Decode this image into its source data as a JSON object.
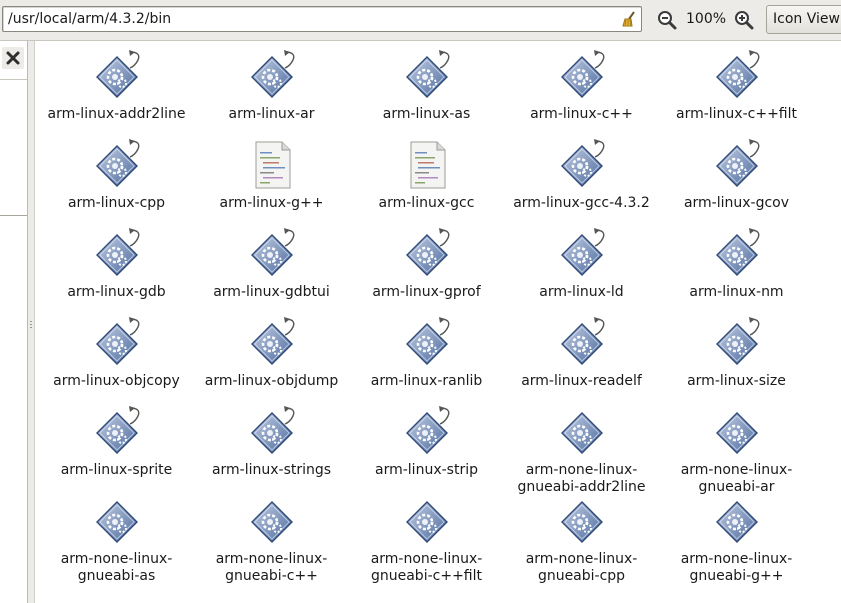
{
  "toolbar": {
    "path": "/usr/local/arm/4.3.2/bin",
    "zoom_level": "100%",
    "view_mode": "Icon View",
    "icons": {
      "clear": "broom-icon",
      "zoom_out": "zoom-out-icon",
      "zoom_in": "zoom-in-icon"
    }
  },
  "sidepane": {
    "close_icon": "close-icon"
  },
  "files": [
    {
      "line1": "arm-linux-addr2line",
      "line2": "",
      "kind": "executable",
      "symlink": true
    },
    {
      "line1": "arm-linux-ar",
      "line2": "",
      "kind": "executable",
      "symlink": true
    },
    {
      "line1": "arm-linux-as",
      "line2": "",
      "kind": "executable",
      "symlink": true
    },
    {
      "line1": "arm-linux-c++",
      "line2": "",
      "kind": "executable",
      "symlink": true
    },
    {
      "line1": "arm-linux-c++filt",
      "line2": "",
      "kind": "executable",
      "symlink": true
    },
    {
      "line1": "arm-linux-cpp",
      "line2": "",
      "kind": "executable",
      "symlink": true
    },
    {
      "line1": "arm-linux-g++",
      "line2": "",
      "kind": "script",
      "symlink": false
    },
    {
      "line1": "arm-linux-gcc",
      "line2": "",
      "kind": "script",
      "symlink": false
    },
    {
      "line1": "arm-linux-gcc-4.3.2",
      "line2": "",
      "kind": "executable",
      "symlink": true
    },
    {
      "line1": "arm-linux-gcov",
      "line2": "",
      "kind": "executable",
      "symlink": true
    },
    {
      "line1": "arm-linux-gdb",
      "line2": "",
      "kind": "executable",
      "symlink": true
    },
    {
      "line1": "arm-linux-gdbtui",
      "line2": "",
      "kind": "executable",
      "symlink": true
    },
    {
      "line1": "arm-linux-gprof",
      "line2": "",
      "kind": "executable",
      "symlink": true
    },
    {
      "line1": "arm-linux-ld",
      "line2": "",
      "kind": "executable",
      "symlink": true
    },
    {
      "line1": "arm-linux-nm",
      "line2": "",
      "kind": "executable",
      "symlink": true
    },
    {
      "line1": "arm-linux-objcopy",
      "line2": "",
      "kind": "executable",
      "symlink": true
    },
    {
      "line1": "arm-linux-objdump",
      "line2": "",
      "kind": "executable",
      "symlink": true
    },
    {
      "line1": "arm-linux-ranlib",
      "line2": "",
      "kind": "executable",
      "symlink": true
    },
    {
      "line1": "arm-linux-readelf",
      "line2": "",
      "kind": "executable",
      "symlink": true
    },
    {
      "line1": "arm-linux-size",
      "line2": "",
      "kind": "executable",
      "symlink": true
    },
    {
      "line1": "arm-linux-sprite",
      "line2": "",
      "kind": "executable",
      "symlink": true
    },
    {
      "line1": "arm-linux-strings",
      "line2": "",
      "kind": "executable",
      "symlink": true
    },
    {
      "line1": "arm-linux-strip",
      "line2": "",
      "kind": "executable",
      "symlink": true
    },
    {
      "line1": "arm-none-linux-",
      "line2": "gnueabi-addr2line",
      "kind": "executable",
      "symlink": false
    },
    {
      "line1": "arm-none-linux-",
      "line2": "gnueabi-ar",
      "kind": "executable",
      "symlink": false
    },
    {
      "line1": "arm-none-linux-",
      "line2": "gnueabi-as",
      "kind": "executable",
      "symlink": false
    },
    {
      "line1": "arm-none-linux-",
      "line2": "gnueabi-c++",
      "kind": "executable",
      "symlink": false
    },
    {
      "line1": "arm-none-linux-",
      "line2": "gnueabi-c++filt",
      "kind": "executable",
      "symlink": false
    },
    {
      "line1": "arm-none-linux-",
      "line2": "gnueabi-cpp",
      "kind": "executable",
      "symlink": false
    },
    {
      "line1": "arm-none-linux-",
      "line2": "gnueabi-g++",
      "kind": "executable",
      "symlink": false
    }
  ],
  "colors": {
    "exec_icon_light": "#c3cfe4",
    "exec_icon_dark": "#4c6a9e",
    "symlink_arrow": "#555753",
    "toolbar_bg": "#ecebe7"
  }
}
